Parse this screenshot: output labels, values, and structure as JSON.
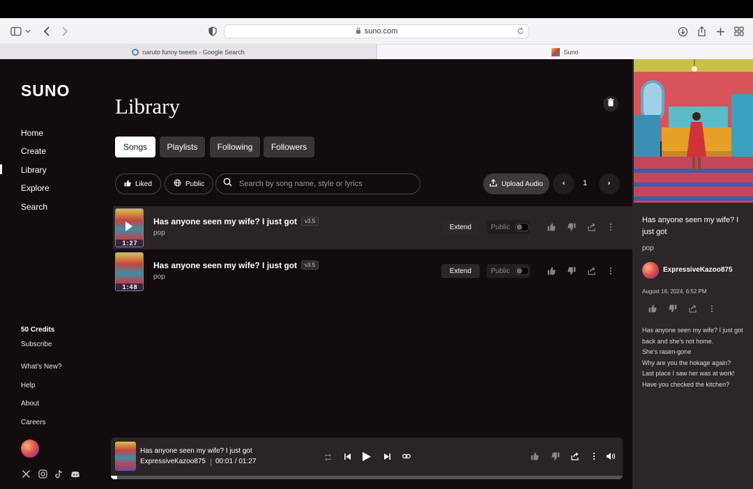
{
  "browser": {
    "url": "suno.com",
    "tabs": [
      {
        "label": "naruto funny tweets - Google Search",
        "favicon": "google-icon"
      },
      {
        "label": "Suno",
        "favicon": "suno-favicon"
      }
    ]
  },
  "sidebar": {
    "logo": "SUNO",
    "nav": [
      "Home",
      "Create",
      "Library",
      "Explore",
      "Search"
    ],
    "active": "Library",
    "credits": "50 Credits",
    "links": [
      "Subscribe",
      "What's New?",
      "Help",
      "About",
      "Careers"
    ],
    "social_icons": [
      "x-icon",
      "instagram-icon",
      "tiktok-icon",
      "discord-icon"
    ]
  },
  "library": {
    "title": "Library",
    "tabs": [
      "Songs",
      "Playlists",
      "Following",
      "Followers"
    ],
    "active_tab": "Songs",
    "filters": {
      "liked": "Liked",
      "public": "Public"
    },
    "search_placeholder": "Search by song name, style or lyrics",
    "upload_label": "Upload Audio",
    "page": "1",
    "songs": [
      {
        "title": "Has anyone seen my wife? I just got",
        "version": "v3.5",
        "style": "pop",
        "duration": "1:27",
        "extend": "Extend",
        "visibility": "Public",
        "selected": true
      },
      {
        "title": "Has anyone seen my wife? I just got",
        "version": "v3.5",
        "style": "pop",
        "duration": "1:48",
        "extend": "Extend",
        "visibility": "Public",
        "selected": false
      }
    ]
  },
  "player": {
    "title": "Has anyone seen my wife? I just got",
    "artist": "ExpressiveKazoo875",
    "time": "00:01 / 01:27",
    "progress": 0.012
  },
  "details": {
    "title": "Has anyone seen my wife? I just got",
    "style": "pop",
    "user": "ExpressiveKazoo875",
    "date": "August 16, 2024, 6:52 PM",
    "lyrics": [
      "Has anyone seen my wife? I just got",
      "back and she's not home.",
      "She's rasen-gone",
      "Why are you the hokage again?",
      "Last place I saw her was at work!",
      "Have you checked the kitchen?"
    ]
  },
  "colors": {
    "background": "#120c0e",
    "panel": "#2c2628",
    "accent": "#ffffff"
  }
}
